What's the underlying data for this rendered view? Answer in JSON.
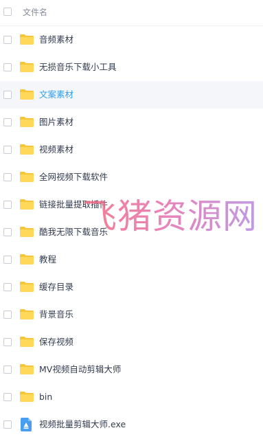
{
  "header": {
    "label": "文件名"
  },
  "files": [
    {
      "name": "音频素材",
      "type": "folder"
    },
    {
      "name": "无损音乐下载小工具",
      "type": "folder"
    },
    {
      "name": "文案素材",
      "type": "folder",
      "hover": true
    },
    {
      "name": "图片素材",
      "type": "folder"
    },
    {
      "name": "视频素材",
      "type": "folder"
    },
    {
      "name": "全网视频下载软件",
      "type": "folder"
    },
    {
      "name": "链接批量提取插件",
      "type": "folder"
    },
    {
      "name": "酷我无限下载音乐",
      "type": "folder"
    },
    {
      "name": "教程",
      "type": "folder"
    },
    {
      "name": "缓存目录",
      "type": "folder"
    },
    {
      "name": "背景音乐",
      "type": "folder"
    },
    {
      "name": "保存视频",
      "type": "folder"
    },
    {
      "name": "MV视频自动剪辑大师",
      "type": "folder"
    },
    {
      "name": "bin",
      "type": "folder"
    },
    {
      "name": "视频批量剪辑大师.exe",
      "type": "exe"
    }
  ],
  "watermark": "飞猪资源网",
  "colors": {
    "folder": "#ffd85a",
    "folder_tab": "#f8c537",
    "accent": "#2f9ef0",
    "exe": "#4a9ef0"
  }
}
